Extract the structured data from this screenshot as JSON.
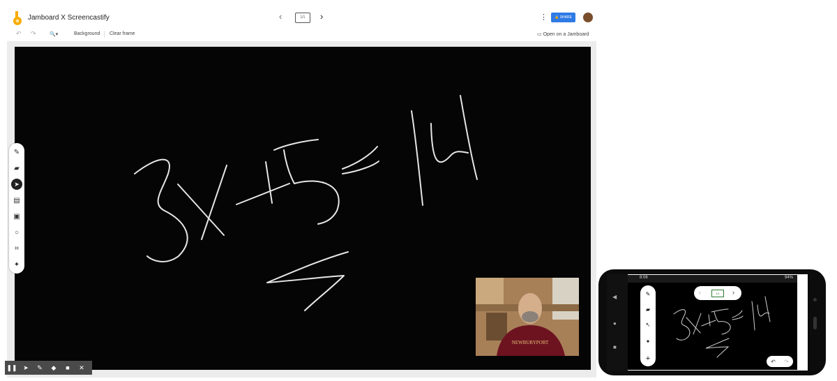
{
  "app": {
    "title": "Jamboard X Screencastify"
  },
  "topbar": {
    "frame_indicator": "1/1",
    "share_label": "SHARE",
    "open_label": "Open on a Jamboard"
  },
  "toolbar": {
    "background_label": "Background",
    "clear_label": "Clear frame"
  },
  "canvas": {
    "handwriting": "3x+5=14"
  },
  "recorder": {
    "controls": [
      "pause",
      "cursor",
      "pen",
      "eraser",
      "camera",
      "close"
    ]
  },
  "phone": {
    "time": "8:06",
    "battery": "94%",
    "frame_indicator": "1/1"
  }
}
